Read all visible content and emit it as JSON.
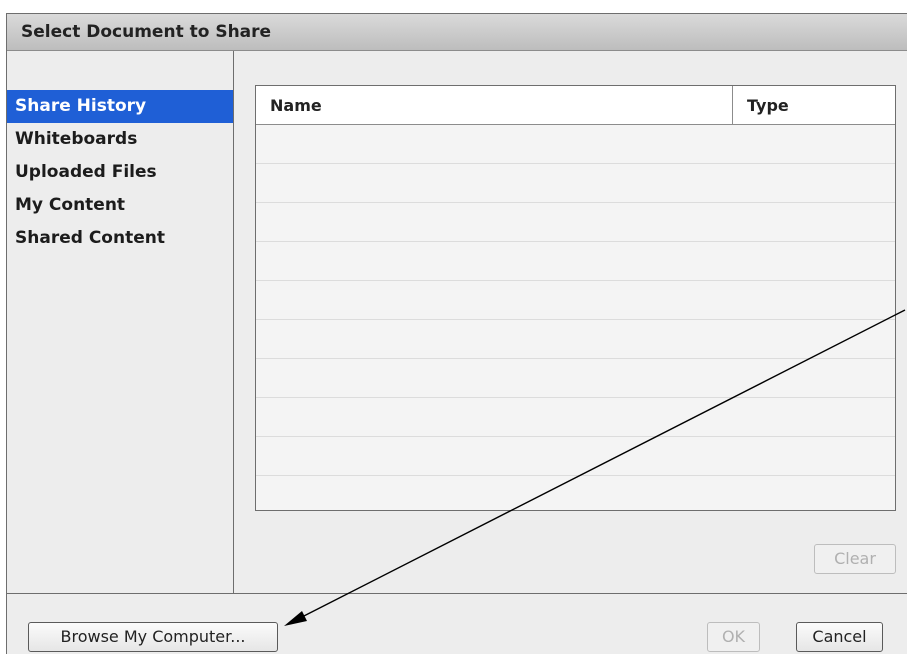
{
  "dialog": {
    "title": "Select Document to Share"
  },
  "sidebar": {
    "items": [
      {
        "label": "Share History",
        "selected": true
      },
      {
        "label": "Whiteboards",
        "selected": false
      },
      {
        "label": "Uploaded Files",
        "selected": false
      },
      {
        "label": "My Content",
        "selected": false
      },
      {
        "label": "Shared Content",
        "selected": false
      }
    ]
  },
  "table": {
    "columns": [
      "Name",
      "Type"
    ],
    "rows": []
  },
  "buttons": {
    "clear": {
      "label": "Clear",
      "enabled": false
    },
    "browse": {
      "label": "Browse My Computer...",
      "enabled": true
    },
    "ok": {
      "label": "OK",
      "enabled": false
    },
    "cancel": {
      "label": "Cancel",
      "enabled": true
    }
  },
  "colors": {
    "selection": "#1f5fd6",
    "dialog_bg": "#ededed",
    "annotation": "#000000"
  }
}
